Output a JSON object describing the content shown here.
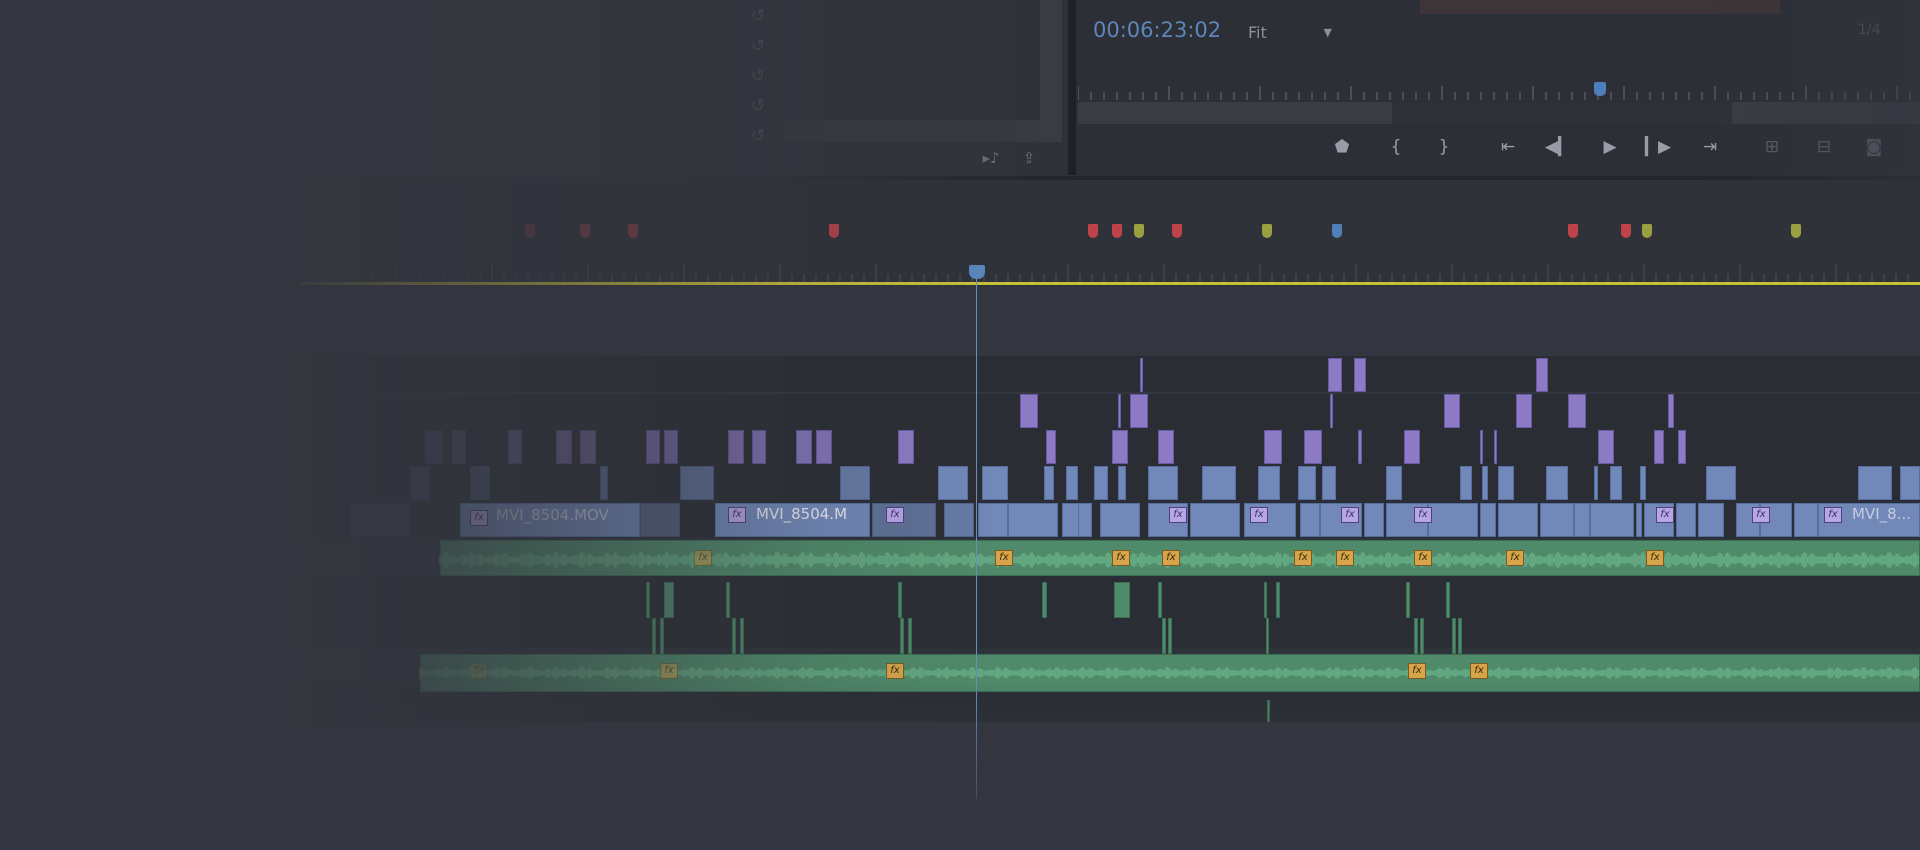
{
  "app": "Video editor (Premiere-style)",
  "program_monitor": {
    "timecode": "00:06:23:02",
    "zoom_label": "Fit",
    "ratio_label": "1/4"
  },
  "clip_labels": {
    "v1_clip_a": "MVI_8504.MOV",
    "v1_clip_b": "MVI_8504.M",
    "v1_clip_c": "MVI_8..."
  },
  "fx_label": "fx",
  "icons": {
    "undo": "undo-icon",
    "source_insert": "insert-audio-icon",
    "source_export": "export-frame-icon",
    "add_marker": "add-marker-icon",
    "mark_in": "mark-in-icon",
    "mark_out": "mark-out-icon",
    "go_to_in": "go-to-in-icon",
    "step_back": "step-back-icon",
    "play": "play-icon",
    "step_forward": "step-forward-icon",
    "go_to_out": "go-to-out-icon",
    "lift": "lift-icon",
    "extract": "extract-icon",
    "export_frame": "camera-icon"
  },
  "colors": {
    "background": "#34363f",
    "timecode": "#5f86b8",
    "playhead": "#5a86bd",
    "work_area": "#c9c03a",
    "video_clip": "#8c7bc4",
    "video_clip_blue": "#7188b8",
    "audio_clip": "#4f8a6a",
    "marker_red": "#c0434a",
    "marker_olive": "#9aa040",
    "marker_blue": "#4f7fba"
  }
}
